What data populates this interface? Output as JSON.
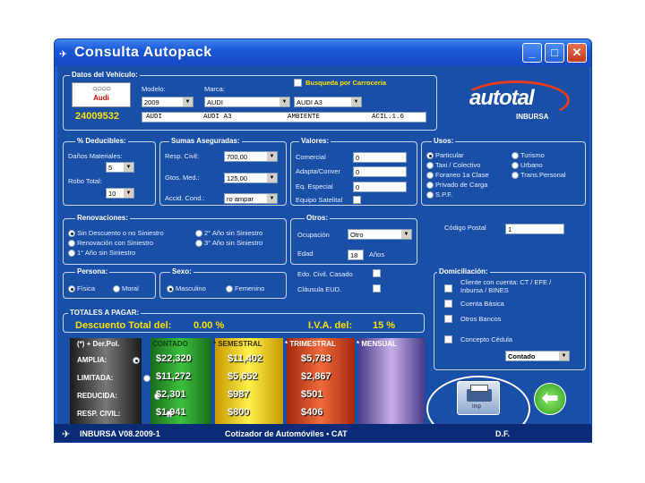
{
  "window": {
    "title": "Consulta  Autopack",
    "minimize": "_",
    "maximize": "□",
    "close": "✕"
  },
  "datos": {
    "header": "Datos del Vehículo:",
    "brand_logo_text": "Audi",
    "vehicle_code": "24009532",
    "modelo_label": "Modelo:",
    "modelo_value": "2009",
    "marca_label": "Marca:",
    "marca_value": "AUDI",
    "submodel_value": "AUDI A3",
    "busqueda_label": "Busqueda por Carroceria",
    "desc": [
      "AUDI",
      "AUDI A3",
      "AMBIENTE",
      "ACIL.1.6"
    ]
  },
  "logo": {
    "main": "autotal",
    "sub": "INBURSA"
  },
  "deducibles": {
    "header": "% Deducibles:",
    "danos_label": "Daños Materiales:",
    "danos_value": "5",
    "robo_label": "Robo Total:",
    "robo_value": "10"
  },
  "sumas": {
    "header": "Sumas Aseguradas:",
    "rc_label": "Resp. Civil:",
    "rc_value": "700,00",
    "gm_label": "Gtos. Med.:",
    "gm_value": "125,00",
    "ac_label": "Accid. Cond.:",
    "ac_value": "ro ampar"
  },
  "valores": {
    "header": "Valores:",
    "comercial_label": "Comercial",
    "comercial_value": "0",
    "adapt_label": "Adapta/Conver",
    "adapt_value": "0",
    "eq_label": "Eq. Especial",
    "eq_value": "0",
    "sat_label": "Equipo Satelital"
  },
  "usos": {
    "header": "Usos:",
    "items": [
      "Particular",
      "Taxi / Colectivo",
      "Foraneo 1a Clase",
      "Privado de Carga",
      "S.P.F.",
      "Turismo",
      "Urbano",
      "Trans.Personal"
    ],
    "selected": "Particular"
  },
  "renovaciones": {
    "header": "Renovaciones:",
    "items": [
      "Sin Descuento o no Siniestro",
      "Renovación con Siniestro",
      "1° Año sin Siniestro",
      "2° Año sin Siniestro",
      "3° Año sin Siniestro"
    ],
    "selected": "Sin Descuento o no Siniestro"
  },
  "otros": {
    "header": "Otros:",
    "ocupacion_label": "Ocupación",
    "ocupacion_value": "Otro",
    "edad_label": "Edad",
    "edad_value": "18",
    "edad_unit": "Años",
    "civil_label": "Edo. Civil. Casado",
    "clausula_label": "Cláusula EUD."
  },
  "codigo": {
    "label": "Código Postal",
    "value": "1"
  },
  "persona": {
    "header": "Persona:",
    "fisica": "Física",
    "moral": "Moral"
  },
  "sexo": {
    "header": "Sexo:",
    "masculino": "Masculino",
    "femenino": "Femenino"
  },
  "domiciliacion": {
    "header": "Domiciliación:",
    "items": [
      "Cliente con cuenta: CT / EFE / Inbursa / BINES",
      "Cuenta Básica",
      "Otros Bancos",
      "Concepto Cédula"
    ],
    "pago_value": "Contado"
  },
  "totales": {
    "header": "TOTALES A PAGAR:",
    "descuento_label": "Descuento Total del:",
    "descuento_value": "0.00 %",
    "iva_label": "I.V.A. del:",
    "iva_value": "15 %",
    "derpol": "(*) + Der.Pol.",
    "cols": [
      "CONTADO",
      "* SEMESTRAL",
      "* TRIMESTRAL",
      "* MENSUAL"
    ],
    "rows": [
      {
        "label": "AMPLIA:",
        "contado": "$22,320",
        "semestral": "$11,402",
        "trimestral": "$5,783"
      },
      {
        "label": "LIMITADA:",
        "contado": "$11,272",
        "semestral": "$5,652",
        "trimestral": "$2,867"
      },
      {
        "label": "REDUCIDA:",
        "contado": "$2,301",
        "semestral": "$987",
        "trimestral": "$501"
      },
      {
        "label": "RESP. CIVIL:",
        "contado": "$1,941",
        "semestral": "$800",
        "trimestral": "$406"
      }
    ]
  },
  "actions": {
    "print_label": "Imp"
  },
  "status": {
    "left": "INBURSA V08.2009-1",
    "center": "Cotizador de Automóviles  •  CAT",
    "right": "D.F."
  },
  "colors": {
    "window_blue": "#1d5fd0",
    "panel_blue": "#1a4fa8",
    "contado": "#2e8b2e",
    "semestral": "#e0c100",
    "trimestral": "#c8451c",
    "mensual": "#7a5fae"
  }
}
